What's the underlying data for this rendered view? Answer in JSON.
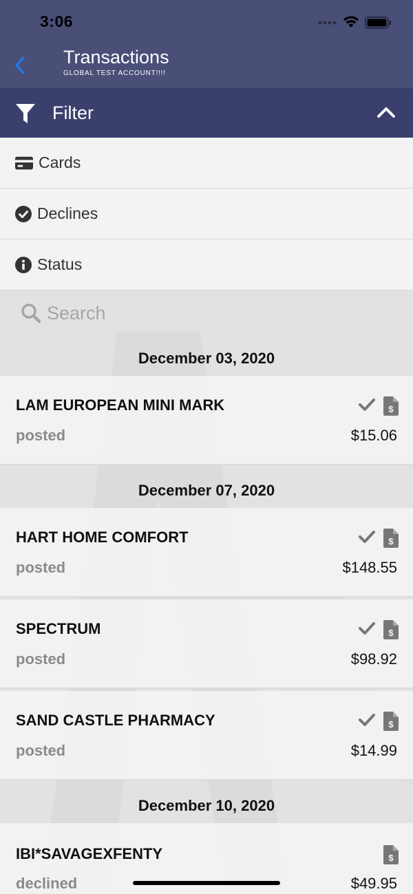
{
  "status_bar": {
    "time": "3:06"
  },
  "header": {
    "title": "Transactions",
    "subtitle": "GLOBAL TEST ACCOUNT!!!!"
  },
  "filter": {
    "label": "Filter",
    "options": [
      {
        "label": "Cards",
        "icon": "credit-card-icon"
      },
      {
        "label": "Declines",
        "icon": "check-circle-icon"
      },
      {
        "label": "Status",
        "icon": "info-circle-icon"
      }
    ]
  },
  "search": {
    "placeholder": "Search"
  },
  "groups": [
    {
      "date": "December 03, 2020",
      "items": [
        {
          "merchant": "LAM EUROPEAN MINI MARK",
          "status": "posted",
          "amount": "$15.06",
          "verified": true
        }
      ]
    },
    {
      "date": "December 07, 2020",
      "items": [
        {
          "merchant": "HART HOME COMFORT",
          "status": "posted",
          "amount": "$148.55",
          "verified": true
        },
        {
          "merchant": "SPECTRUM",
          "status": "posted",
          "amount": "$98.92",
          "verified": true
        },
        {
          "merchant": "SAND CASTLE PHARMACY",
          "status": "posted",
          "amount": "$14.99",
          "verified": true
        }
      ]
    },
    {
      "date": "December 10, 2020",
      "items": [
        {
          "merchant": "IBI*SAVAGEXFENTY",
          "status": "declined",
          "amount": "$49.95",
          "verified": false
        }
      ]
    }
  ],
  "colors": {
    "nav_bg": "#4a4f78",
    "filter_bg": "#3a3f6b",
    "back_arrow": "#1e7cf2",
    "list_bg": "#e2e2e2"
  }
}
